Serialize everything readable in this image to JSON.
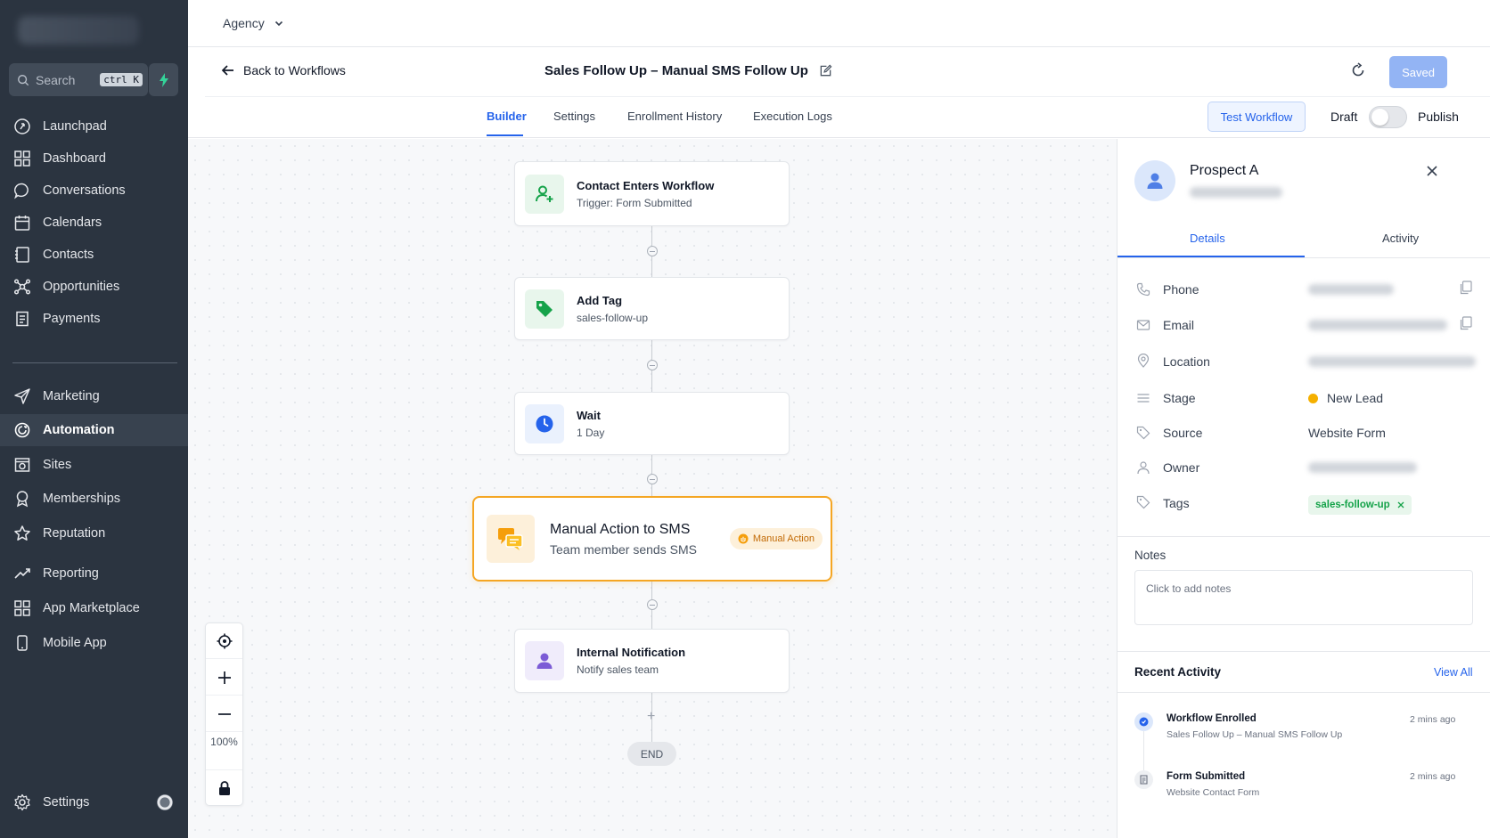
{
  "sidebar": {
    "search": {
      "placeholder": "Search",
      "shortcut": "ctrl K"
    },
    "nav_top": [
      {
        "label": "Launchpad",
        "icon": "rocket-icon"
      },
      {
        "label": "Dashboard",
        "icon": "grid-icon"
      },
      {
        "label": "Conversations",
        "icon": "chat-icon"
      },
      {
        "label": "Calendars",
        "icon": "calendar-icon"
      },
      {
        "label": "Contacts",
        "icon": "contact-book-icon"
      },
      {
        "label": "Opportunities",
        "icon": "network-icon"
      },
      {
        "label": "Payments",
        "icon": "receipt-icon"
      }
    ],
    "nav_bottom": [
      {
        "label": "Marketing",
        "icon": "send-icon"
      },
      {
        "label": "Automation",
        "icon": "automation-icon",
        "active": true
      },
      {
        "label": "Sites",
        "icon": "sites-icon"
      },
      {
        "label": "Memberships",
        "icon": "award-icon"
      },
      {
        "label": "Reputation",
        "icon": "star-icon"
      },
      {
        "label": "Reporting",
        "icon": "trend-icon"
      },
      {
        "label": "App Marketplace",
        "icon": "grid-icon"
      },
      {
        "label": "Mobile App",
        "icon": "phone-icon"
      }
    ],
    "settings_label": "Settings"
  },
  "topbar": {
    "account": "Agency"
  },
  "header": {
    "back_label": "Back to Workflows",
    "workflow_title": "Sales Follow Up – Manual SMS Follow Up",
    "saved_label": "Saved"
  },
  "tabs": {
    "items": [
      "Builder",
      "Settings",
      "Enrollment History",
      "Execution Logs"
    ],
    "active": "Builder",
    "test_label": "Test Workflow",
    "draft_label": "Draft",
    "publish_label": "Publish",
    "published": false
  },
  "workflow": {
    "nodes": [
      {
        "title": "Contact Enters Workflow",
        "subtitle": "Trigger: Form Submitted",
        "icon": "user-plus-icon",
        "color": "#16a34a"
      },
      {
        "title": "Add Tag",
        "subtitle": "sales-follow-up",
        "icon": "tag-icon",
        "color": "#16a34a"
      },
      {
        "title": "Wait",
        "subtitle": "1 Day",
        "icon": "clock-icon",
        "color": "#2563eb"
      },
      {
        "title": "Manual Action to SMS",
        "subtitle": "Team member sends SMS",
        "icon": "sms-icon",
        "color": "#f59e0b",
        "badge": "Manual Action"
      },
      {
        "title": "Internal Notification",
        "subtitle": "Notify sales team",
        "icon": "user-icon",
        "color": "#7c5cd6"
      }
    ],
    "end_label": "END",
    "zoom_level": "100%"
  },
  "contact_panel": {
    "name": "Prospect A",
    "tabs": [
      "Details",
      "Activity"
    ],
    "active_tab": "Details",
    "fields": [
      {
        "label": "Phone",
        "icon": "phone-icon"
      },
      {
        "label": "Email",
        "icon": "mail-icon"
      },
      {
        "label": "Location",
        "icon": "location-pin-icon"
      },
      {
        "label": "Stage",
        "icon": "list-icon",
        "value": "New Lead",
        "status_color": "#f5b000"
      },
      {
        "label": "Source",
        "icon": "tag-outline-icon",
        "value": "Website Form"
      },
      {
        "label": "Owner",
        "icon": "person-icon"
      },
      {
        "label": "Tags",
        "icon": "tag-outline-icon",
        "value": "sales-follow-up"
      }
    ],
    "notes_label": "Notes",
    "notes_placeholder": "Click to add notes",
    "recent_activity_title": "Recent Activity",
    "view_all_label": "View All",
    "activities": [
      {
        "title": "Workflow Enrolled",
        "subtitle": "Sales Follow Up – Manual SMS Follow Up",
        "time": "2 mins ago"
      },
      {
        "title": "Form Submitted",
        "subtitle": "Website Contact Form",
        "time": "2 mins ago"
      }
    ]
  },
  "colors": {
    "sidebar_bg": "#2b3440",
    "accent": "#2563eb",
    "highlight": "#f5a623"
  }
}
